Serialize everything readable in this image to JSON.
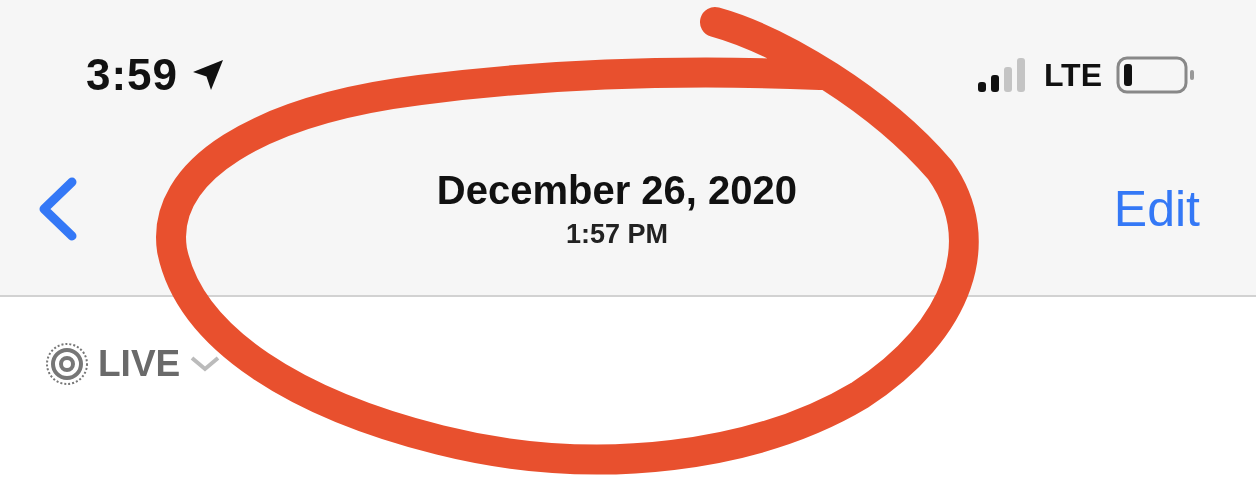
{
  "status_bar": {
    "time": "3:59",
    "network": "LTE"
  },
  "nav_bar": {
    "title": "December 26, 2020",
    "subtitle": "1:57 PM",
    "action": "Edit"
  },
  "live_button": {
    "label": "LIVE"
  }
}
